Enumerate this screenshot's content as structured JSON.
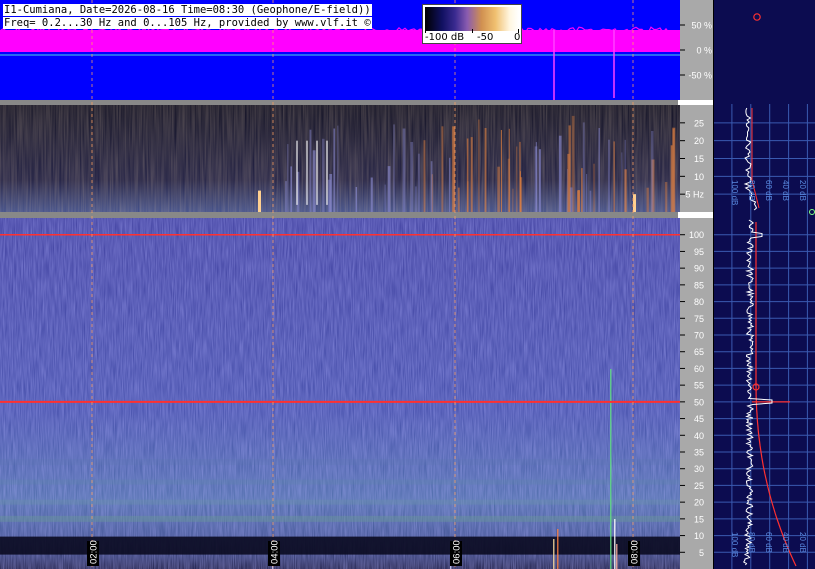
{
  "header": {
    "line1": "I1-Cumiana, Date=2026-08-16 Time=08:30 (Geophone/E-field))",
    "line2": "Freq= 0.2...30 Hz and 0...105 Hz, provided by www.vlf.it ©"
  },
  "colorbar": {
    "labels": [
      "-100 dB",
      "-50",
      "0"
    ]
  },
  "colors": {
    "plot_background": "#1c1c7a",
    "trace_fill": "#0000ff",
    "magenta_band": "#ff00ff",
    "hum_line": "#ff3030",
    "axis_panel": "#a9a9a9",
    "profile_background": "#0c0c50",
    "marker": "#ff5050"
  },
  "chart_data": [
    {
      "type": "area",
      "panel": "amplitude-trace",
      "y_unit": "%",
      "ylim": [
        -100,
        100
      ],
      "yticks": [
        "50 %",
        "0 %",
        "-50 %"
      ]
    },
    {
      "type": "heatmap",
      "panel": "low-frequency-spectrogram",
      "ylim": [
        0,
        30
      ],
      "yticks": [
        "25",
        "20",
        "15",
        "10",
        "5 Hz"
      ]
    },
    {
      "type": "heatmap",
      "panel": "main-spectrogram",
      "ylim": [
        0,
        105
      ],
      "yticks": [
        "100",
        "95",
        "90",
        "85",
        "80",
        "75",
        "70",
        "65",
        "60",
        "55",
        "50",
        "45",
        "40",
        "35",
        "30",
        "25",
        "20",
        "15",
        "10",
        "5"
      ],
      "xticks": [
        "02:00",
        "04:00",
        "06:00",
        "08:00"
      ],
      "hum_lines_hz": [
        50,
        100
      ]
    },
    {
      "type": "line",
      "panel": "spectrum-profile-upper",
      "xticks": [
        "100 dB",
        "80 dB",
        "60 dB",
        "40 dB",
        "20 dB"
      ]
    },
    {
      "type": "line",
      "panel": "spectrum-profile-lower",
      "xticks": [
        "100 dB",
        "80 dB",
        "60 dB",
        "40 dB",
        "20 dB"
      ],
      "peaks_hz": [
        50,
        100
      ]
    }
  ]
}
